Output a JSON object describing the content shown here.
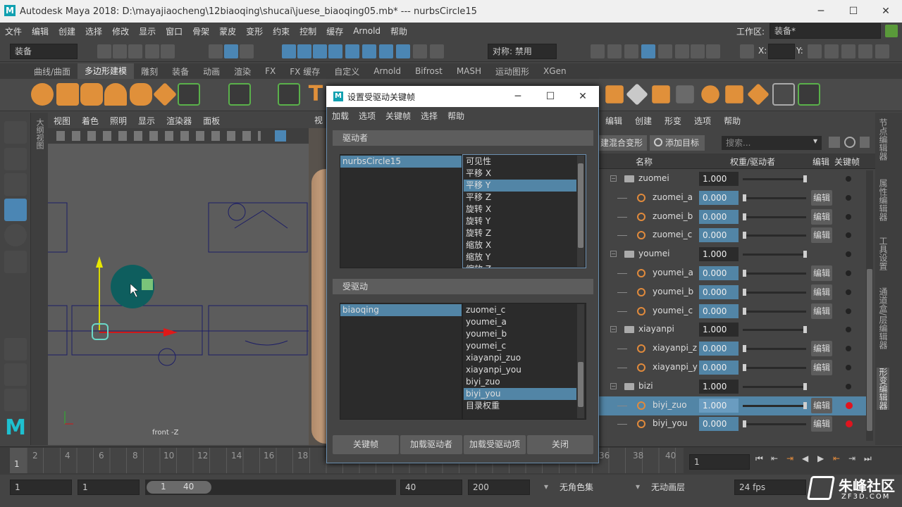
{
  "window": {
    "title": "Autodesk Maya 2018: D:\\mayajiaocheng\\12biaoqing\\shucai\\juese_biaoqing05.mb*   ---   nurbsCircle15",
    "min": "─",
    "max": "☐",
    "close": "✕"
  },
  "menubar": [
    "文件",
    "编辑",
    "创建",
    "选择",
    "修改",
    "显示",
    "窗口",
    "骨架",
    "蒙皮",
    "变形",
    "约束",
    "控制",
    "缓存",
    "Arnold",
    "帮助"
  ],
  "workspace": {
    "label": "工作区:",
    "value": "装备*"
  },
  "statusline": {
    "menuset": "装备",
    "symmetry": "对称: 禁用",
    "x": "X:",
    "y": "Y:"
  },
  "shelf_tabs": [
    "曲线/曲面",
    "多边形建模",
    "雕刻",
    "装备",
    "动画",
    "渲染",
    "FX",
    "FX 缓存",
    "自定义",
    "Arnold",
    "Bifrost",
    "MASH",
    "运动图形",
    "XGen"
  ],
  "shelf_active": 1,
  "viewport": {
    "menu": [
      "视图",
      "着色",
      "照明",
      "显示",
      "渲染器",
      "面板"
    ],
    "camera_label": "front -Z",
    "side_label": "大纲视图",
    "extra_menu": "视"
  },
  "shape_editor": {
    "menu": [
      "编辑",
      "创建",
      "形变",
      "选项",
      "帮助"
    ],
    "create_blend": "建混合变形",
    "add_target": "添加目标",
    "search_placeholder": "搜索...",
    "headers": {
      "name": "名称",
      "weight": "权重/驱动者",
      "edit": "编辑",
      "key": "关键帧"
    },
    "rows": [
      {
        "name": "zuomei",
        "type": "group",
        "value": "1.000",
        "edit": "",
        "key": "dot"
      },
      {
        "name": "zuomei_a",
        "type": "target",
        "value": "0.000",
        "edit": "编辑",
        "key": "dot"
      },
      {
        "name": "zuomei_b",
        "type": "target",
        "value": "0.000",
        "edit": "编辑",
        "key": "dot"
      },
      {
        "name": "zuomei_c",
        "type": "target",
        "value": "0.000",
        "edit": "编辑",
        "key": "dot"
      },
      {
        "name": "youmei",
        "type": "group",
        "value": "1.000",
        "edit": "",
        "key": "dot"
      },
      {
        "name": "youmei_a",
        "type": "target",
        "value": "0.000",
        "edit": "编辑",
        "key": "dot"
      },
      {
        "name": "youmei_b",
        "type": "target",
        "value": "0.000",
        "edit": "编辑",
        "key": "dot"
      },
      {
        "name": "youmei_c",
        "type": "target",
        "value": "0.000",
        "edit": "编辑",
        "key": "dot"
      },
      {
        "name": "xiayanpi",
        "type": "group",
        "value": "1.000",
        "edit": "",
        "key": "dot"
      },
      {
        "name": "xiayanpi_zu",
        "type": "target",
        "value": "0.000",
        "edit": "编辑",
        "key": "dot"
      },
      {
        "name": "xiayanpi_yc",
        "type": "target",
        "value": "0.000",
        "edit": "编辑",
        "key": "dot"
      },
      {
        "name": "bizi",
        "type": "group",
        "value": "1.000",
        "edit": "",
        "key": "dot"
      },
      {
        "name": "biyi_zuo",
        "type": "target-selected",
        "value": "1.000",
        "edit": "编辑",
        "key": "red"
      },
      {
        "name": "biyi_you",
        "type": "target",
        "value": "0.000",
        "edit": "编辑",
        "key": "red"
      }
    ]
  },
  "right_tabs": [
    "节点编辑器",
    "属性编辑器",
    "工具设置",
    "通道盒/层编辑器",
    "形变编辑器"
  ],
  "dialog": {
    "title": "设置受驱动关键帧",
    "menu": [
      "加载",
      "选项",
      "关键帧",
      "选择",
      "帮助"
    ],
    "driver_section": "驱动者",
    "driver_object": "nurbsCircle15",
    "driver_attrs": [
      "可见性",
      "平移 X",
      "平移 Y",
      "平移 Z",
      "旋转 X",
      "旋转 Y",
      "旋转 Z",
      "缩放 X",
      "缩放 Y",
      "缩放 Z"
    ],
    "driver_selected": 2,
    "driven_section": "受驱动",
    "driven_object": "biaoqing",
    "driven_attrs": [
      "zuomei_c",
      "youmei_a",
      "youmei_b",
      "youmei_c",
      "xiayanpi_zuo",
      "xiayanpi_you",
      "biyi_zuo",
      "biyi_you",
      "目录权重"
    ],
    "driven_selected": 7,
    "buttons": [
      "关键帧",
      "加载驱动者",
      "加载受驱动项",
      "关闭"
    ]
  },
  "timeline": {
    "ticks": [
      "2",
      "4",
      "6",
      "8",
      "10",
      "12",
      "14",
      "16",
      "18",
      "36",
      "38",
      "40"
    ],
    "current_frame": "1",
    "start_label": "1"
  },
  "range": {
    "start": "1",
    "anim_start": "1",
    "range_start": "1",
    "range_end": "40",
    "end": "40",
    "anim_end": "200",
    "charset": "无角色集",
    "animlayer": "无动画层",
    "fps": "24 fps"
  },
  "watermark": {
    "text": "朱峰社区",
    "sub": "ZF3D.COM"
  }
}
